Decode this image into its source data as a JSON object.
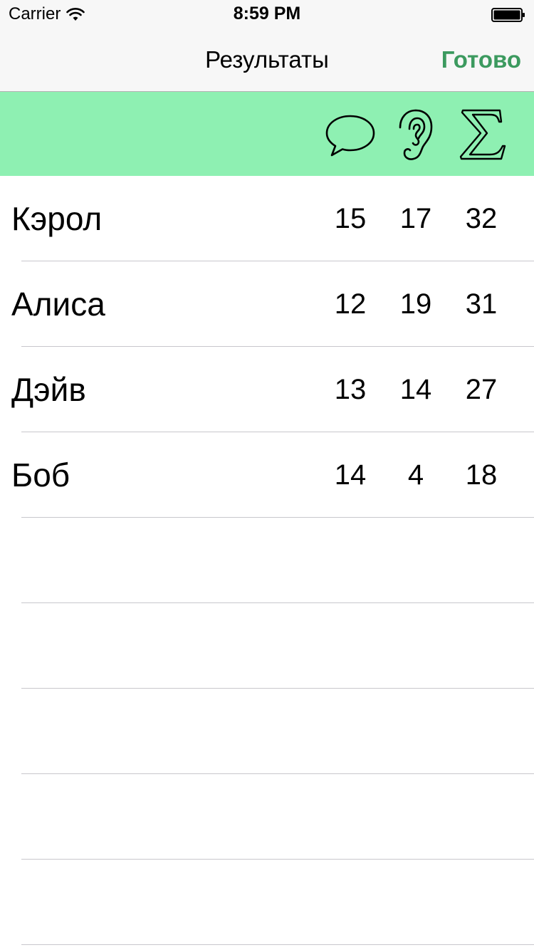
{
  "status_bar": {
    "carrier": "Carrier",
    "time": "8:59 PM"
  },
  "nav": {
    "title": "Результаты",
    "done_label": "Готово",
    "accent_color": "#3c9a5f"
  },
  "header": {
    "background_color": "#8ef0b2",
    "columns": [
      {
        "icon": "speech-bubble-icon"
      },
      {
        "icon": "ear-icon"
      },
      {
        "icon": "sum-sigma-icon"
      }
    ]
  },
  "rows": [
    {
      "name": "Кэрол",
      "speak": "15",
      "listen": "17",
      "total": "32"
    },
    {
      "name": "Алиса",
      "speak": "12",
      "listen": "19",
      "total": "31"
    },
    {
      "name": "Дэйв",
      "speak": "13",
      "listen": "14",
      "total": "27"
    },
    {
      "name": "Боб",
      "speak": "14",
      "listen": "4",
      "total": "18"
    }
  ]
}
